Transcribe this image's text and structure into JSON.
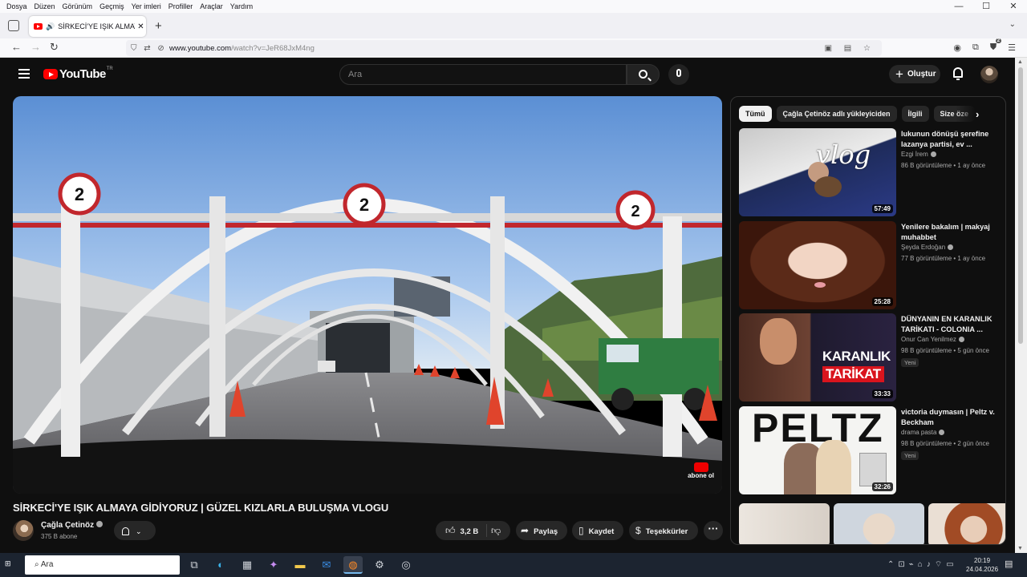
{
  "browser": {
    "menu": [
      "Dosya",
      "Düzen",
      "Görünüm",
      "Geçmiş",
      "Yer imleri",
      "Profiller",
      "Araçlar",
      "Yardım"
    ],
    "window_controls": {
      "minimize": "—",
      "maximize": "☐",
      "close": "✕"
    },
    "tab": {
      "title": "SİRKECİ'YE IŞIK ALMAYA Gİ",
      "close": "✕"
    },
    "new_tab": "+",
    "url_host": "www.youtube.com",
    "url_path": "/watch?v=JeR68JxM4ng",
    "extension_badge": "2"
  },
  "youtube": {
    "logo_text": "YouTube",
    "logo_country": "TR",
    "search_placeholder": "Ara",
    "create_label": "Oluştur"
  },
  "video": {
    "title": "SİRKECİ'YE IŞIK ALMAYA GİDİYORUZ | GÜZEL KIZLARLA BULUŞMA VLOGU",
    "watermark": "abone ol",
    "channel_name": "Çağla Çetinöz",
    "subscribers": "375 B abone",
    "likes": "3,2 B",
    "share_label": "Paylaş",
    "save_label": "Kaydet",
    "thanks_label": "Teşekkürler"
  },
  "sidebar": {
    "chips": [
      "Tümü",
      "Çağla Çetinöz adlı yükleyiciden",
      "İlgili",
      "Size öze"
    ],
    "recommendations": [
      {
        "title": "lukunun dönüşü şerefine lazanya partisi, ev ...",
        "channel": "Ezgi İrem",
        "meta": "86 B görüntüleme • 1 ay önce",
        "duration": "57:49",
        "badge": ""
      },
      {
        "title": "Yenilere bakalım | makyaj muhabbet",
        "channel": "Şeyda Erdoğan",
        "meta": "77 B görüntüleme • 1 ay önce",
        "duration": "25:28",
        "badge": ""
      },
      {
        "title": "DÜNYANIN EN KARANLIK TARİKATI - COLONIA ...",
        "channel": "Onur Can Yenilmez",
        "meta": "98 B görüntüleme • 5 gün önce",
        "duration": "33:33",
        "badge": "Yeni"
      },
      {
        "title": "victoria duymasın | Peltz v. Beckham",
        "channel": "drama pasta",
        "meta": "98 B görüntüleme • 2 gün önce",
        "duration": "32:26",
        "badge": "Yeni"
      }
    ],
    "thumb_texts": {
      "vlog": "vlog",
      "karanlik": "KARANLIK",
      "tarikat": "TARİKAT",
      "peltz": "PELTZ"
    }
  },
  "taskbar": {
    "search_placeholder": "Ara",
    "time": "20:19",
    "date": "24.04.2026"
  }
}
